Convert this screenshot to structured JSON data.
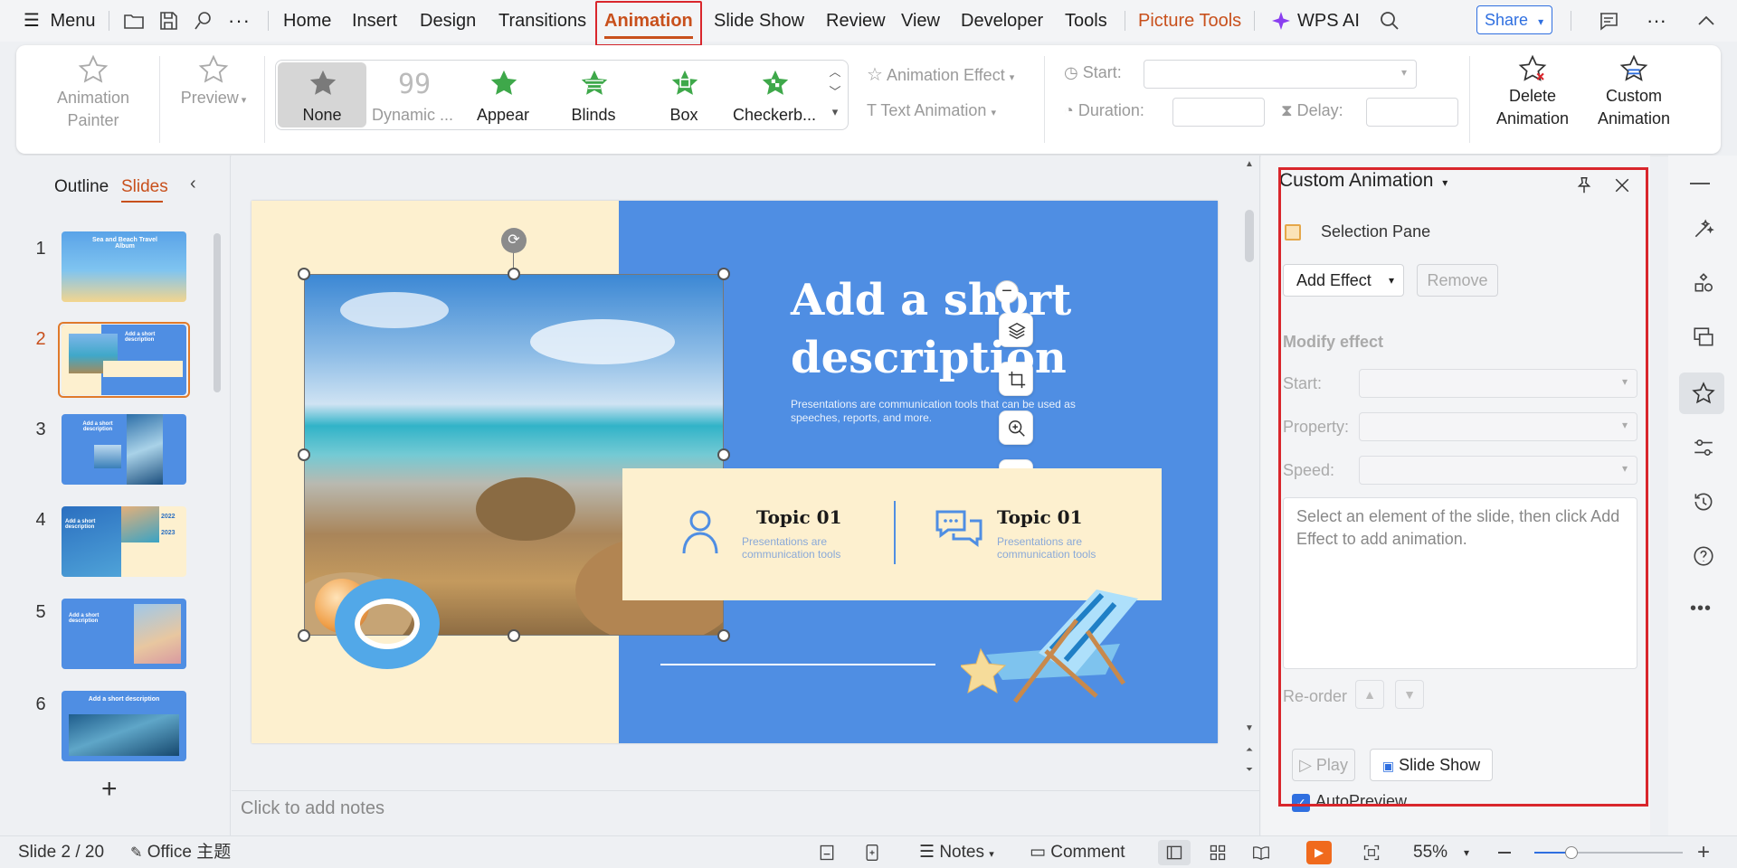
{
  "menubar": {
    "menu_label": "Menu",
    "tabs": [
      "Home",
      "Insert",
      "Design",
      "Transitions",
      "Animation",
      "Slide Show",
      "Review",
      "View",
      "Developer",
      "Tools"
    ],
    "active_tab": "Animation",
    "picture_tools": "Picture Tools",
    "wps_ai": "WPS AI",
    "share": "Share",
    "accent_color": "#c8501c",
    "highlight_color": "#d9262c"
  },
  "ribbon": {
    "animation_painter": "Animation Painter",
    "preview": "Preview",
    "gallery": [
      "None",
      "Dynamic ...",
      "Appear",
      "Blinds",
      "Box",
      "Checkerb..."
    ],
    "animation_effect": "Animation Effect",
    "text_animation": "Text Animation",
    "start_label": "Start:",
    "duration_label": "Duration:",
    "delay_label": "Delay:",
    "delete_animation": "Delete Animation",
    "custom_animation": "Custom Animation"
  },
  "left_panel": {
    "outline_tab": "Outline",
    "slides_tab": "Slides",
    "slide_numbers": [
      "1",
      "2",
      "3",
      "4",
      "5",
      "6"
    ],
    "selected_slide": "2",
    "thumb1_title": "Sea and Beach Travel Album",
    "thumb_add_title": "Add a short description",
    "thumb4_nums": [
      "2022",
      "2023"
    ]
  },
  "slide": {
    "title": "Add a short description",
    "subtitle": "Presentations are communication tools that can be used as speeches, reports, and more.",
    "topic1_title": "Topic 01",
    "topic1_text": "Presentations are communication tools",
    "topic2_title": "Topic 01",
    "topic2_text": "Presentations are communication tools"
  },
  "notes": {
    "placeholder": "Click to add notes"
  },
  "custom_animation": {
    "title": "Custom Animation",
    "selection_pane": "Selection Pane",
    "add_effect": "Add Effect",
    "remove": "Remove",
    "modify_effect": "Modify effect",
    "start_label": "Start:",
    "property_label": "Property:",
    "speed_label": "Speed:",
    "hint": "Select an element of the slide, then click Add Effect to add animation.",
    "reorder_label": "Re-order",
    "play": "Play",
    "slide_show": "Slide Show",
    "autopreview": "AutoPreview",
    "autopreview_checked": true
  },
  "statusbar": {
    "slide_info": "Slide 2 / 20",
    "theme": "Office 主题",
    "notes": "Notes",
    "comment": "Comment",
    "zoom": "55%"
  }
}
